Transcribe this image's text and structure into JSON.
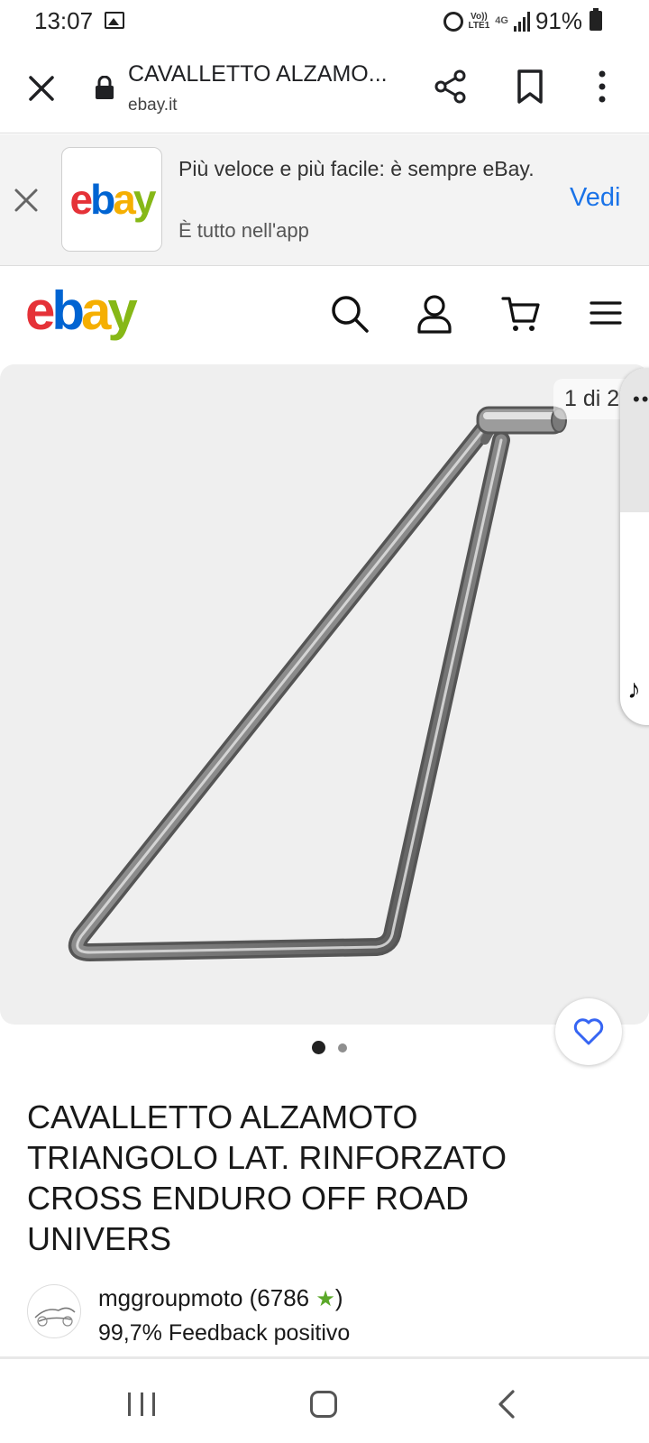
{
  "status_bar": {
    "time": "13:07",
    "network_top": "Vo))",
    "network_bottom": "LTE1",
    "network_type": "4G",
    "battery": "91%",
    "icons": [
      "gallery-icon",
      "alarm-icon",
      "signal-icon",
      "battery-icon"
    ]
  },
  "browser": {
    "page_title": "CAVALLETTO ALZAMO...",
    "url": "ebay.it",
    "icons": [
      "close-icon",
      "lock-icon",
      "share-icon",
      "bookmark-icon",
      "more-icon"
    ]
  },
  "app_banner": {
    "logo": "ebay",
    "line1": "Più veloce e più facile: è sempre eBay.",
    "line2": "È tutto nell'app",
    "action": "Vedi"
  },
  "header": {
    "logo": "ebay",
    "icons": [
      "search-icon",
      "user-icon",
      "cart-icon",
      "menu-icon"
    ]
  },
  "gallery": {
    "counter": "1 di 2",
    "current_index": 1,
    "total": 2,
    "image": "triangle-side-stand"
  },
  "product": {
    "title": "CAVALLETTO ALZAMOTO TRIANGOLO LAT. RINFORZATO CROSS ENDURO OFF ROAD UNIVERS"
  },
  "seller": {
    "name": "mggroupmoto (6786",
    "star": "★",
    "closing": ")",
    "feedback": "99,7% Feedback positivo"
  },
  "colors": {
    "ebay_red": "#e53238",
    "ebay_blue": "#0064d2",
    "ebay_yellow": "#f5af02",
    "ebay_green": "#86b817",
    "link_blue": "#1a73e8",
    "favorite_blue": "#3665f3"
  }
}
